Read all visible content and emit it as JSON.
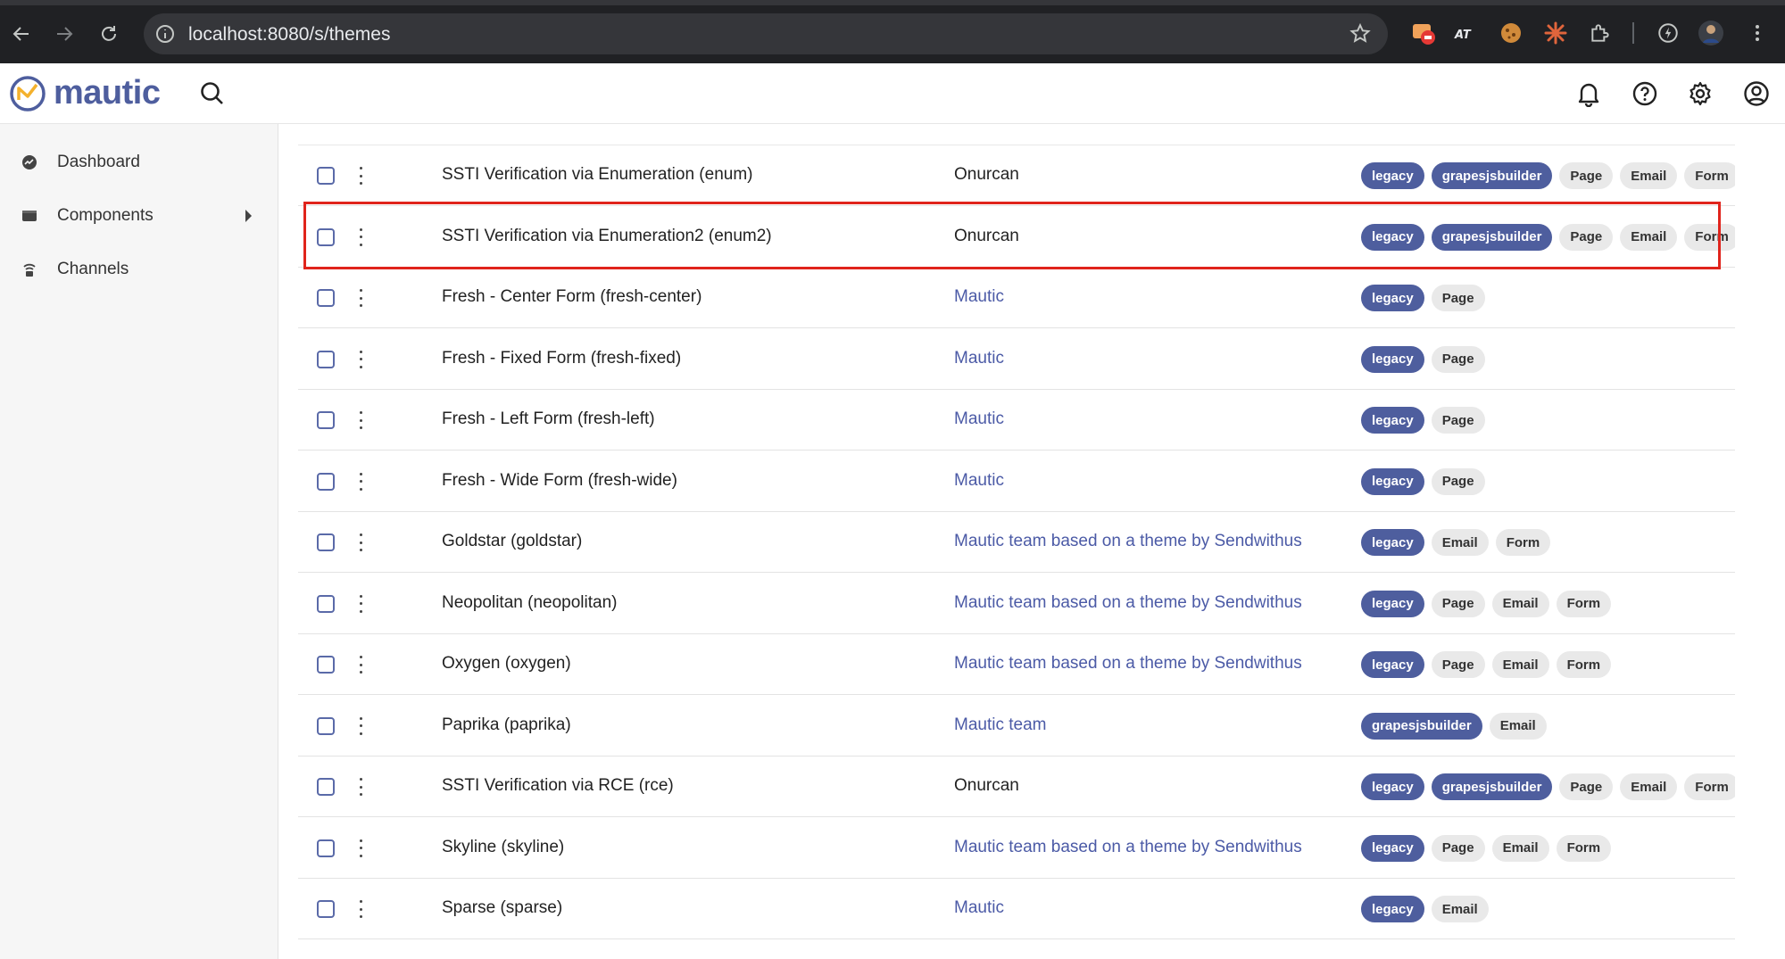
{
  "browser": {
    "url": "localhost:8080/s/themes"
  },
  "app": {
    "logo_text": "mautic"
  },
  "sidebar": {
    "items": [
      {
        "label": "Dashboard"
      },
      {
        "label": "Components"
      },
      {
        "label": "Channels"
      }
    ]
  },
  "themes": {
    "rows": [
      {
        "name": "SSTI Verification via Enumeration (enum)",
        "author": "Onurcan",
        "author_link": false,
        "tags": [
          {
            "label": "legacy",
            "style": "dark"
          },
          {
            "label": "grapesjsbuilder",
            "style": "dark"
          },
          {
            "label": "Page",
            "style": "light"
          },
          {
            "label": "Email",
            "style": "light"
          },
          {
            "label": "Form",
            "style": "light"
          }
        ]
      },
      {
        "name": "SSTI Verification via Enumeration2 (enum2)",
        "author": "Onurcan",
        "author_link": false,
        "tags": [
          {
            "label": "legacy",
            "style": "dark"
          },
          {
            "label": "grapesjsbuilder",
            "style": "dark"
          },
          {
            "label": "Page",
            "style": "light"
          },
          {
            "label": "Email",
            "style": "light"
          },
          {
            "label": "Form",
            "style": "light"
          }
        ]
      },
      {
        "name": "Fresh - Center Form (fresh-center)",
        "author": "Mautic",
        "author_link": true,
        "tags": [
          {
            "label": "legacy",
            "style": "dark"
          },
          {
            "label": "Page",
            "style": "light"
          }
        ]
      },
      {
        "name": "Fresh - Fixed Form (fresh-fixed)",
        "author": "Mautic",
        "author_link": true,
        "tags": [
          {
            "label": "legacy",
            "style": "dark"
          },
          {
            "label": "Page",
            "style": "light"
          }
        ]
      },
      {
        "name": "Fresh - Left Form (fresh-left)",
        "author": "Mautic",
        "author_link": true,
        "tags": [
          {
            "label": "legacy",
            "style": "dark"
          },
          {
            "label": "Page",
            "style": "light"
          }
        ]
      },
      {
        "name": "Fresh - Wide Form (fresh-wide)",
        "author": "Mautic",
        "author_link": true,
        "tags": [
          {
            "label": "legacy",
            "style": "dark"
          },
          {
            "label": "Page",
            "style": "light"
          }
        ]
      },
      {
        "name": "Goldstar (goldstar)",
        "author": "Mautic team based on a theme by Sendwithus",
        "author_link": true,
        "tags": [
          {
            "label": "legacy",
            "style": "dark"
          },
          {
            "label": "Email",
            "style": "light"
          },
          {
            "label": "Form",
            "style": "light"
          }
        ]
      },
      {
        "name": "Neopolitan (neopolitan)",
        "author": "Mautic team based on a theme by Sendwithus",
        "author_link": true,
        "tags": [
          {
            "label": "legacy",
            "style": "dark"
          },
          {
            "label": "Page",
            "style": "light"
          },
          {
            "label": "Email",
            "style": "light"
          },
          {
            "label": "Form",
            "style": "light"
          }
        ]
      },
      {
        "name": "Oxygen (oxygen)",
        "author": "Mautic team based on a theme by Sendwithus",
        "author_link": true,
        "tags": [
          {
            "label": "legacy",
            "style": "dark"
          },
          {
            "label": "Page",
            "style": "light"
          },
          {
            "label": "Email",
            "style": "light"
          },
          {
            "label": "Form",
            "style": "light"
          }
        ]
      },
      {
        "name": "Paprika (paprika)",
        "author": "Mautic team",
        "author_link": true,
        "tags": [
          {
            "label": "grapesjsbuilder",
            "style": "dark"
          },
          {
            "label": "Email",
            "style": "light"
          }
        ]
      },
      {
        "name": "SSTI Verification via RCE (rce)",
        "author": "Onurcan",
        "author_link": false,
        "tags": [
          {
            "label": "legacy",
            "style": "dark"
          },
          {
            "label": "grapesjsbuilder",
            "style": "dark"
          },
          {
            "label": "Page",
            "style": "light"
          },
          {
            "label": "Email",
            "style": "light"
          },
          {
            "label": "Form",
            "style": "light"
          }
        ]
      },
      {
        "name": "Skyline (skyline)",
        "author": "Mautic team based on a theme by Sendwithus",
        "author_link": true,
        "tags": [
          {
            "label": "legacy",
            "style": "dark"
          },
          {
            "label": "Page",
            "style": "light"
          },
          {
            "label": "Email",
            "style": "light"
          },
          {
            "label": "Form",
            "style": "light"
          }
        ]
      },
      {
        "name": "Sparse (sparse)",
        "author": "Mautic",
        "author_link": true,
        "tags": [
          {
            "label": "legacy",
            "style": "dark"
          },
          {
            "label": "Email",
            "style": "light"
          }
        ]
      }
    ]
  },
  "colors": {
    "brand": "#4e5e9e",
    "highlight": "#e0241c",
    "link": "#4b5aa6"
  }
}
